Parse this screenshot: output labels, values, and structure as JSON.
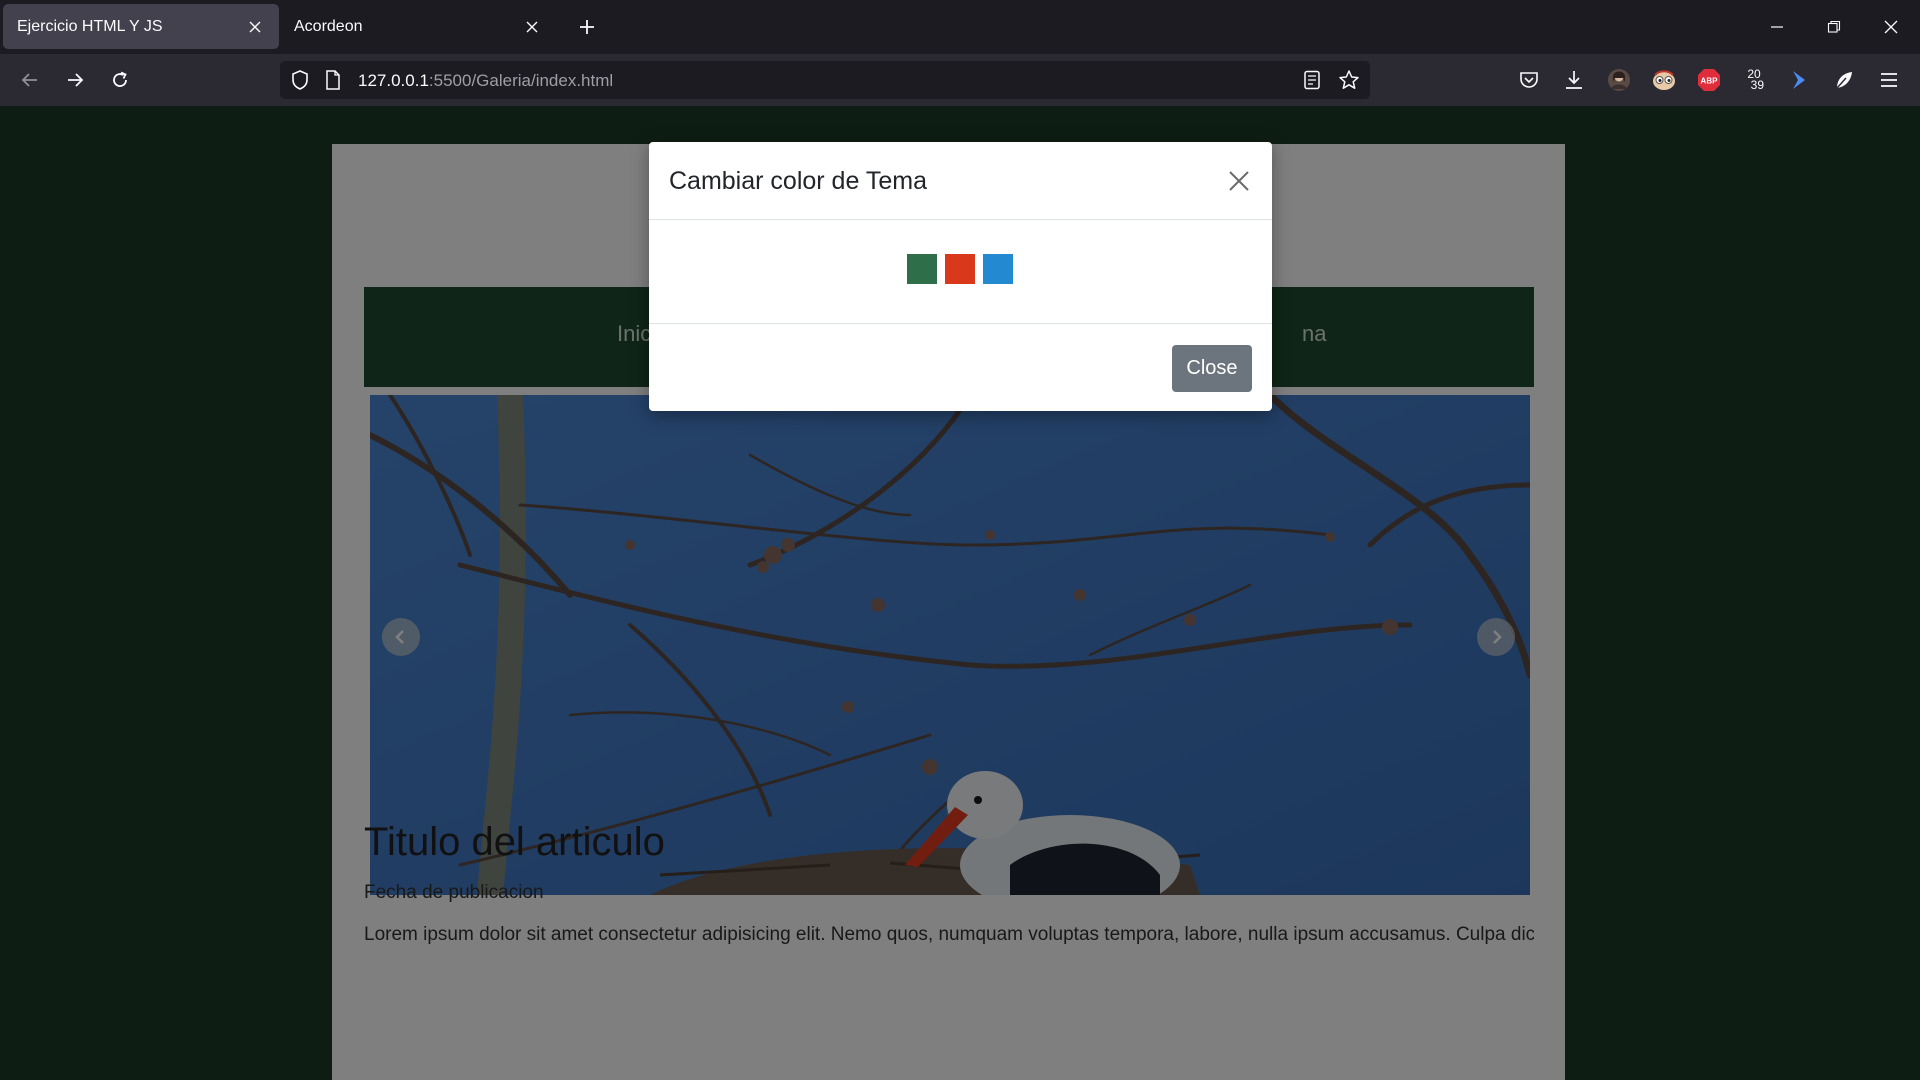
{
  "browser": {
    "tabs": [
      {
        "label": "Ejercicio HTML Y JS",
        "active": true
      },
      {
        "label": "Acordeon",
        "active": false
      }
    ],
    "url_host": "127.0.0.1",
    "url_rest": ":5500/Galeria/index.html",
    "icons": [
      "back-icon",
      "forward-icon",
      "reload-icon",
      "shield-icon",
      "page-icon",
      "reader-view-icon",
      "bookmark-star-icon",
      "pocket-icon",
      "download-icon",
      "avatar-icon",
      "extension-eyes-icon",
      "adblock-plus-icon",
      "extension-2039-icon",
      "extension-arrow-icon",
      "extension-leaf-icon",
      "menu-icon"
    ],
    "ext_2039": "20 39",
    "abp_label": "ABP"
  },
  "page": {
    "nav_left": "Inic",
    "nav_right": "na",
    "article_title": "Titulo del articulo",
    "article_date": "Fecha de publicacion",
    "article_text": "Lorem ipsum dolor sit amet consectetur adipisicing elit. Nemo quos, numquam voluptas tempora, labore, nulla ipsum accusamus. Culpa dic"
  },
  "modal": {
    "title": "Cambiar color de Tema",
    "close_label": "Close",
    "swatches": [
      {
        "name": "green",
        "color": "#2e6e48"
      },
      {
        "name": "red",
        "color": "#d9391a"
      },
      {
        "name": "blue",
        "color": "#2389d0"
      }
    ]
  },
  "colors": {
    "page_background": "#1c3a27",
    "site_nav": "#1f4a2f",
    "close_button": "#6c757d"
  }
}
